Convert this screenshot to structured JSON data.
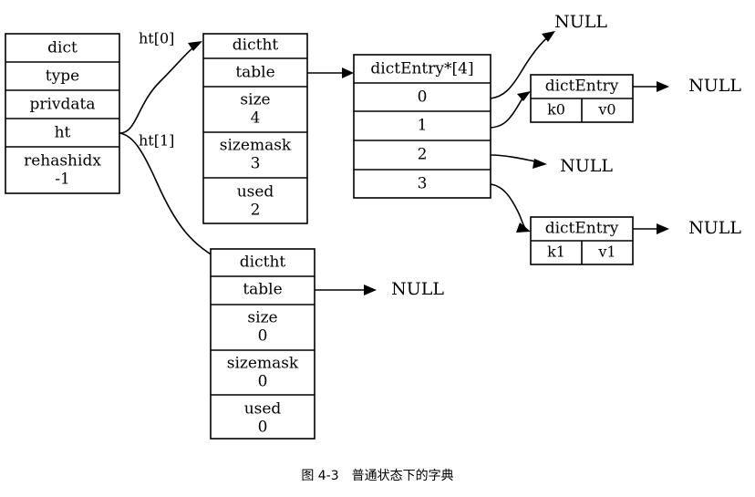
{
  "diagram": {
    "title_caption": "图 4-3　普通状态下的字典",
    "caption_figure_number": "图 4-3",
    "caption_label": "普通状态下的字典",
    "colors": {
      "background": "#ffffff",
      "stroke": "#000000",
      "text": "#000000"
    },
    "dict_struct": {
      "name": "dict",
      "fields": [
        {
          "label": "dict",
          "value": ""
        },
        {
          "label": "type",
          "value": ""
        },
        {
          "label": "privdata",
          "value": ""
        },
        {
          "label": "ht",
          "value": ""
        },
        {
          "label": "rehashidx",
          "value": "-1"
        }
      ]
    },
    "edge_labels": {
      "ht0": "ht[0]",
      "ht1": "ht[1]"
    },
    "dictht0": {
      "name": "dictht",
      "fields": [
        {
          "label": "dictht",
          "value": ""
        },
        {
          "label": "table",
          "value": ""
        },
        {
          "label": "size",
          "value": "4"
        },
        {
          "label": "sizemask",
          "value": "3"
        },
        {
          "label": "used",
          "value": "2"
        }
      ]
    },
    "dictht1": {
      "name": "dictht",
      "fields": [
        {
          "label": "dictht",
          "value": ""
        },
        {
          "label": "table",
          "value": ""
        },
        {
          "label": "size",
          "value": "0"
        },
        {
          "label": "sizemask",
          "value": "0"
        },
        {
          "label": "used",
          "value": "0"
        }
      ]
    },
    "bucket_array": {
      "header": "dictEntry*[4]",
      "slots": [
        "0",
        "1",
        "2",
        "3"
      ]
    },
    "entry0": {
      "header": "dictEntry",
      "key": "k0",
      "value": "v0"
    },
    "entry1": {
      "header": "dictEntry",
      "key": "k1",
      "value": "v1"
    },
    "nulls": {
      "slot0_null": "NULL",
      "slot2_null": "NULL",
      "entry0_next_null": "NULL",
      "entry1_next_null": "NULL",
      "dictht1_table_null": "NULL"
    }
  }
}
